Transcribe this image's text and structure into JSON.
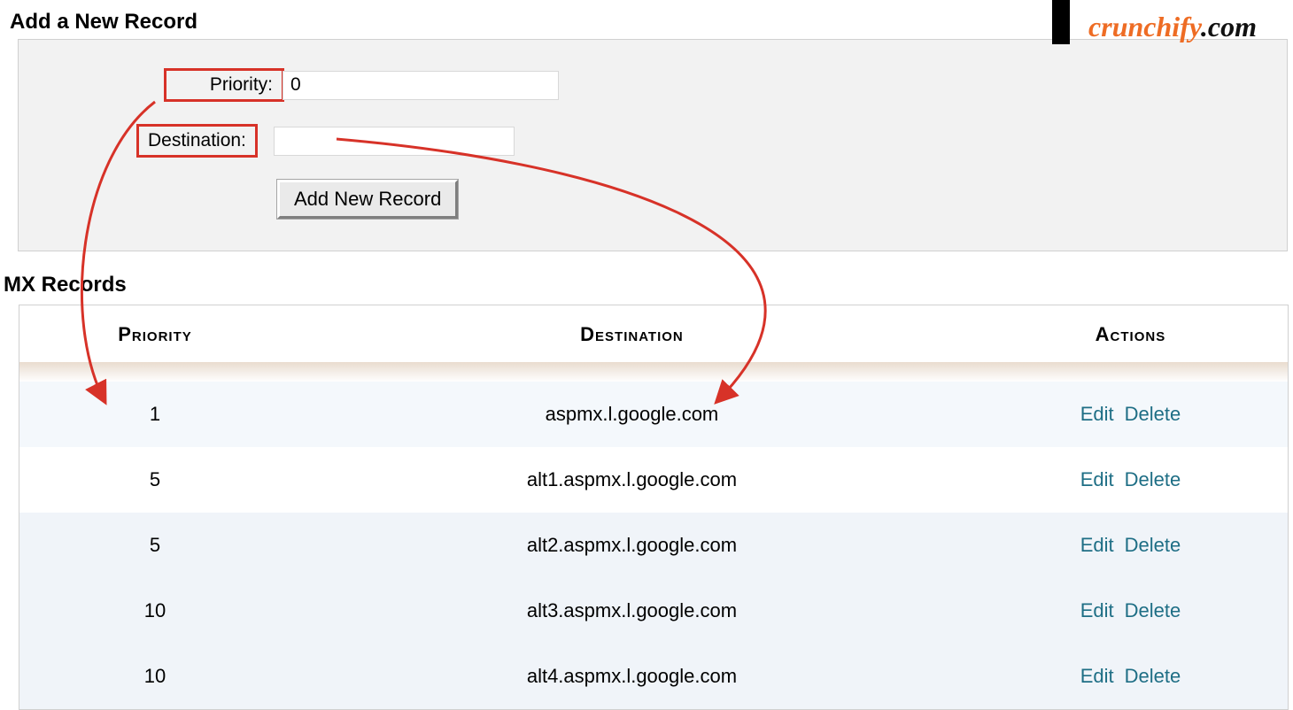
{
  "section1_title": "Add a New Record",
  "section2_title": "MX Records",
  "form": {
    "priority_label": "Priority:",
    "priority_value": "0",
    "destination_label": "Destination:",
    "destination_value": "",
    "submit_label": "Add New Record"
  },
  "table": {
    "headers": {
      "priority": "Priority",
      "destination": "Destination",
      "actions": "Actions"
    },
    "edit_label": "Edit",
    "delete_label": "Delete",
    "rows": [
      {
        "priority": "1",
        "destination": "aspmx.l.google.com"
      },
      {
        "priority": "5",
        "destination": "alt1.aspmx.l.google.com"
      },
      {
        "priority": "5",
        "destination": "alt2.aspmx.l.google.com"
      },
      {
        "priority": "10",
        "destination": "alt3.aspmx.l.google.com"
      },
      {
        "priority": "10",
        "destination": "alt4.aspmx.l.google.com"
      }
    ]
  },
  "watermark": {
    "brand": "crunchify",
    "suffix": ".com"
  }
}
